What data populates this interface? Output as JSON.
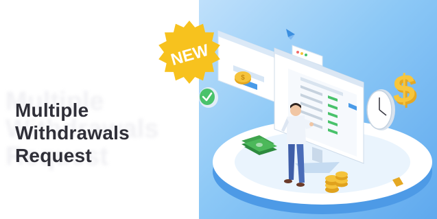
{
  "badge": {
    "text": "NEW"
  },
  "headline": {
    "line1": "Multiple",
    "line2": "Withdrawals",
    "line3": "Request"
  },
  "colors": {
    "badge": "#f7c21e",
    "headline": "#2f2f38",
    "background_blue": "#8cc8f6",
    "coin": "#f5c33b",
    "money": "#3fa34d",
    "accent_green": "#49c26b"
  },
  "icons": [
    "new-badge-icon",
    "checkmark-icon",
    "wall-clock-icon",
    "dollar-sign-icon",
    "coin-stack-icon",
    "banknote-stack-icon",
    "person-icon",
    "monitor-icon"
  ]
}
